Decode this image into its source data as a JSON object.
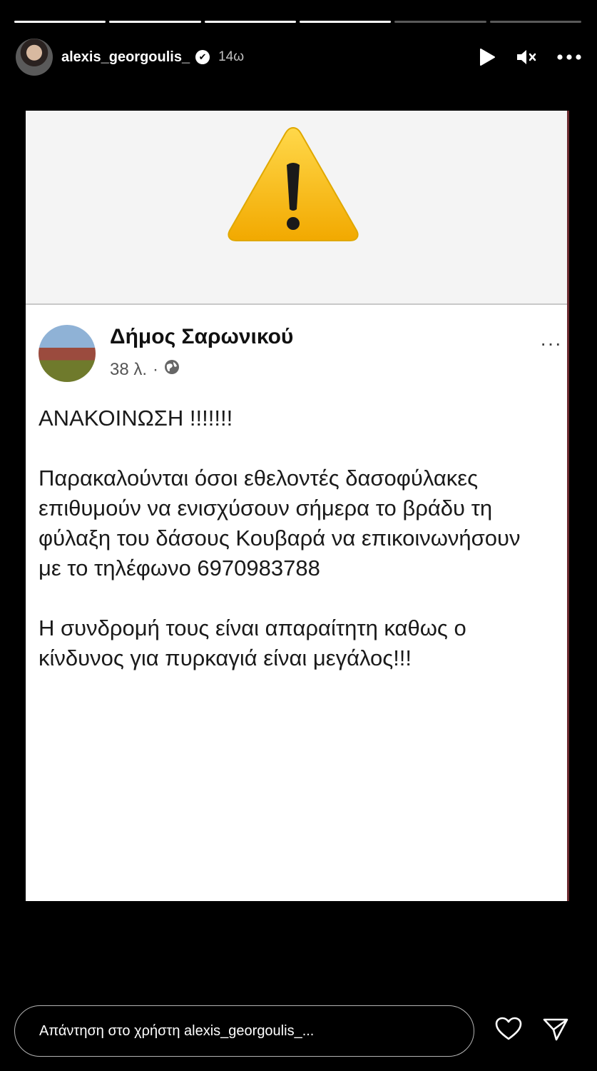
{
  "story": {
    "progress_segments": [
      true,
      true,
      true,
      true,
      false,
      false
    ]
  },
  "header": {
    "username": "alexis_georgoulis_",
    "verified_icon": "✔",
    "time": "14ω"
  },
  "post": {
    "page_name": "Δήμος Σαρωνικού",
    "time": "38 λ.",
    "separator": "·",
    "more": "···",
    "lines": [
      "ΑΝΑΚΟΙΝΩΣΗ !!!!!!!",
      "",
      "Παρακαλούνται όσοι  εθελοντές δασοφύλακες",
      "επιθυμούν να ενισχύσουν σήμερα το βράδυ τη",
      "φύλαξη του δάσους Κουβαρά να επικοινωνήσουν",
      "με το τηλέφωνο 6970983788",
      "",
      "Η συνδρομή τους είναι απαραίτητη καθως ο",
      "κίνδυνος για πυρκαγιά είναι μεγάλος!!!"
    ]
  },
  "reply": {
    "placeholder": "Απάντηση στο χρήστη alexis_georgoulis_..."
  },
  "icons": {
    "play": "play-icon",
    "mute": "mute-icon",
    "more": "more-icon",
    "heart": "heart-icon",
    "send": "send-icon",
    "globe": "globe-icon",
    "warning": "warning-icon"
  }
}
